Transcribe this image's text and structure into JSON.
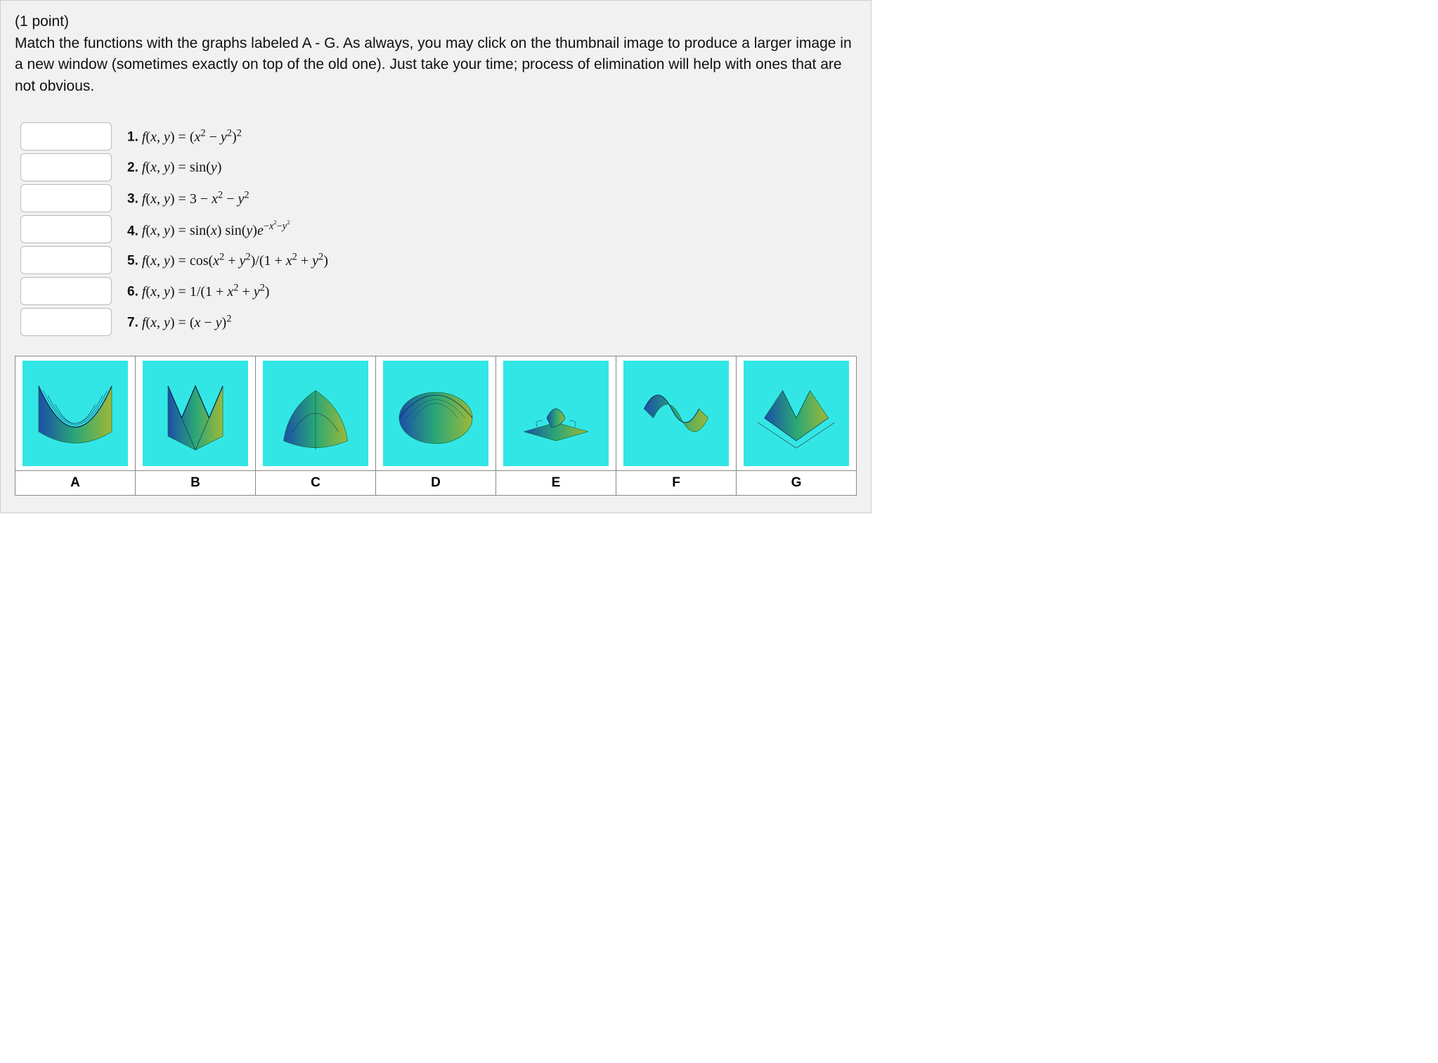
{
  "points": "(1 point)",
  "prompt": "Match the functions with the graphs labeled A - G. As always, you may click on the thumbnail image to produce a larger image in a new window (sometimes exactly on top of the old one). Just take your time; process of elimination will help with ones that are not obvious.",
  "questions": [
    {
      "num": "1.",
      "fn_html": "<i>f</i>(<i>x</i>, <i>y</i>) = (<i>x</i><span class='sup'>2</span> − <i>y</i><span class='sup'>2</span>)<span class='sup'>2</span>"
    },
    {
      "num": "2.",
      "fn_html": "<i>f</i>(<i>x</i>, <i>y</i>) = sin(<i>y</i>)"
    },
    {
      "num": "3.",
      "fn_html": "<i>f</i>(<i>x</i>, <i>y</i>) = 3 − <i>x</i><span class='sup'>2</span> − <i>y</i><span class='sup'>2</span>"
    },
    {
      "num": "4.",
      "fn_html": "<i>f</i>(<i>x</i>, <i>y</i>) = sin(<i>x</i>) sin(<i>y</i>)<i>e</i><span class='sup'>−<i>x</i><span class='ssup'>2</span>−<i>y</i><span class='ssup'>2</span></span>"
    },
    {
      "num": "5.",
      "fn_html": "<i>f</i>(<i>x</i>, <i>y</i>) = cos(<i>x</i><span class='sup'>2</span> + <i>y</i><span class='sup'>2</span>)/(1 + <i>x</i><span class='sup'>2</span> + <i>y</i><span class='sup'>2</span>)"
    },
    {
      "num": "6.",
      "fn_html": "<i>f</i>(<i>x</i>, <i>y</i>) = 1/(1 + <i>x</i><span class='sup'>2</span> + <i>y</i><span class='sup'>2</span>)"
    },
    {
      "num": "7.",
      "fn_html": "<i>f</i>(<i>x</i>, <i>y</i>) = (<i>x</i> − <i>y</i>)<span class='sup'>2</span>"
    }
  ],
  "graphs": [
    "A",
    "B",
    "C",
    "D",
    "E",
    "F",
    "G"
  ]
}
